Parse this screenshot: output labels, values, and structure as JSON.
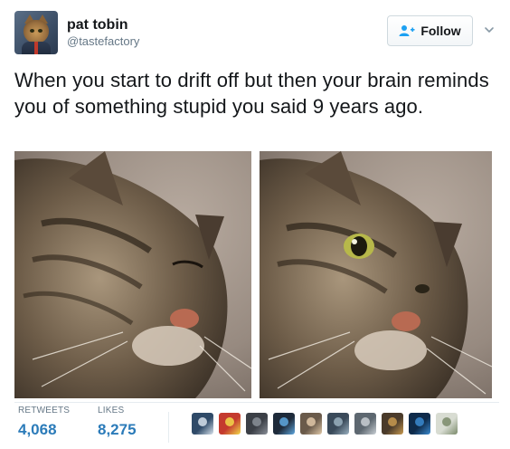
{
  "user": {
    "name": "pat tobin",
    "handle": "@tastefactory",
    "avatar_icon": "cat-in-suit-avatar"
  },
  "follow_button": {
    "label": "Follow",
    "icon": "add-user-icon"
  },
  "more_menu": {
    "icon": "chevron-down-icon"
  },
  "tweet": {
    "text": "When you start to drift off but then your brain reminds you of something stupid you said 9 years ago."
  },
  "media": [
    {
      "subject": "sleeping tabby cat, eyes closed"
    },
    {
      "subject": "tabby cat, one eye wide open"
    }
  ],
  "stats": {
    "retweets_label": "RETWEETS",
    "retweets_value": "4,068",
    "likes_label": "LIKES",
    "likes_value": "8,275"
  },
  "likers": [
    {
      "color": "#2f4a68",
      "accent": "#d8e2ec"
    },
    {
      "color": "#c43a2e",
      "accent": "#f2d94a"
    },
    {
      "color": "#3b3f46",
      "accent": "#8a8f98"
    },
    {
      "color": "#1e2a3a",
      "accent": "#5fa8e0"
    },
    {
      "color": "#6a5a4a",
      "accent": "#e0c8a8"
    },
    {
      "color": "#3a4a5a",
      "accent": "#9ab0c0"
    },
    {
      "color": "#5d6770",
      "accent": "#c9cfd4"
    },
    {
      "color": "#4a3a2a",
      "accent": "#c89a50"
    },
    {
      "color": "#0e2a4a",
      "accent": "#3a8ad0"
    },
    {
      "color": "#d8dcd2",
      "accent": "#7a8a6a"
    }
  ]
}
